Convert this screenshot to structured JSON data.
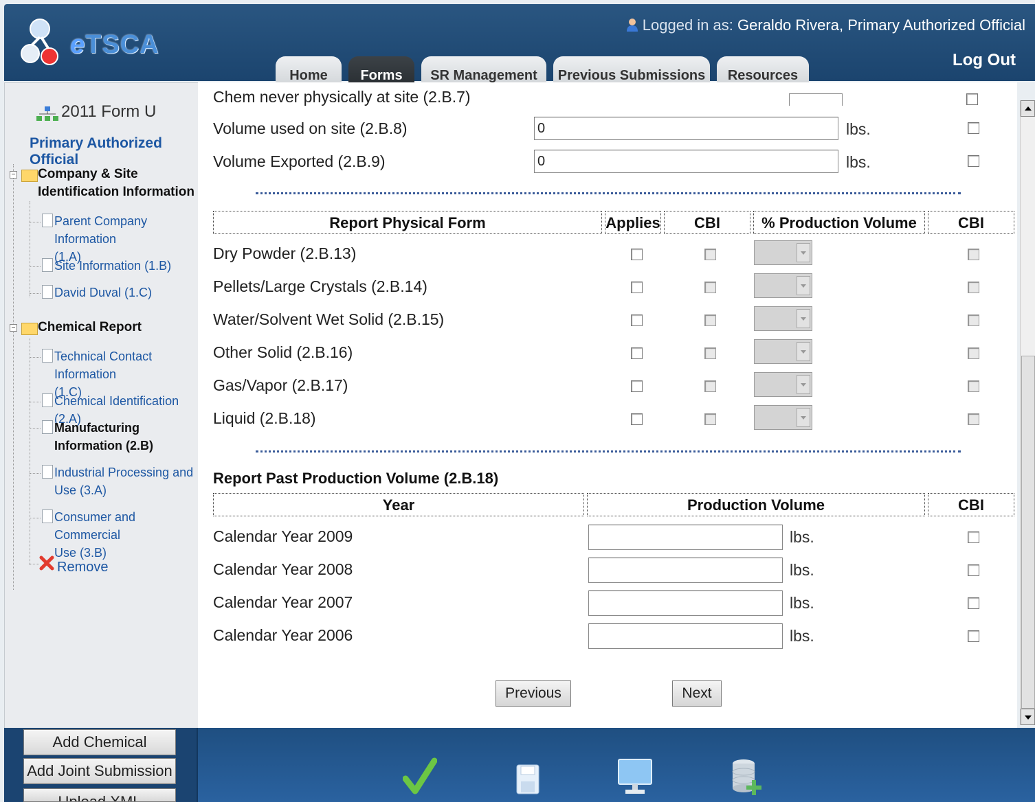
{
  "app": {
    "logo_text_e": "e",
    "logo_text_rest": "TSCA"
  },
  "header": {
    "logged_in_prefix": "Logged in as:",
    "user_name": "Geraldo Rivera, Primary Authorized Official",
    "logout": "Log Out",
    "tabs": [
      {
        "label": "Home",
        "active": false
      },
      {
        "label": "Forms",
        "active": true
      },
      {
        "label": "SR Management",
        "active": false
      },
      {
        "label": "Previous Submissions",
        "active": false
      },
      {
        "label": "Resources",
        "active": false
      }
    ]
  },
  "sidebar": {
    "form_title": "2011 Form U",
    "role": "Primary Authorized Official",
    "folder1": {
      "line1": "Company & Site",
      "line2": "Identification Information"
    },
    "items1": [
      {
        "line1": "Parent Company Information",
        "line2": "(1.A)"
      },
      {
        "line1": "Site Information (1.B)",
        "line2": ""
      },
      {
        "line1": "David Duval (1.C)",
        "line2": ""
      }
    ],
    "folder2": {
      "line1": "Chemical Report"
    },
    "items2": [
      {
        "line1": "Technical Contact Information",
        "line2": "(1.C)"
      },
      {
        "line1": "Chemical Identification (2.A)",
        "line2": ""
      },
      {
        "line1": "Manufacturing",
        "line2": "Information (2.B)"
      },
      {
        "line1": "Industrial Processing and",
        "line2": "Use (3.A)"
      },
      {
        "line1": "Consumer and Commercial",
        "line2": "Use (3.B)"
      }
    ],
    "remove": "Remove",
    "buttons": {
      "add_chemical": "Add Chemical",
      "add_joint": "Add Joint Submission",
      "upload_xml": "Upload XML"
    }
  },
  "main": {
    "partial_top_label": "Chem never physically at site (2.B.7)",
    "volume_rows": [
      {
        "label": "Volume used on site (2.B.8)",
        "value": "0",
        "unit": "lbs."
      },
      {
        "label": "Volume Exported (2.B.9)",
        "value": "0",
        "unit": "lbs."
      }
    ],
    "physical_form": {
      "headers": {
        "form": "Report Physical Form",
        "applies": "Applies",
        "cbi": "CBI",
        "pct": "% Production Volume",
        "cbi2": "CBI"
      },
      "rows": [
        {
          "label": "Dry Powder (2.B.13)"
        },
        {
          "label": "Pellets/Large Crystals (2.B.14)"
        },
        {
          "label": "Water/Solvent Wet Solid (2.B.15)"
        },
        {
          "label": "Other Solid (2.B.16)"
        },
        {
          "label": "Gas/Vapor (2.B.17)"
        },
        {
          "label": "Liquid (2.B.18)"
        }
      ]
    },
    "past_production": {
      "title": "Report Past Production Volume (2.B.18)",
      "headers": {
        "year": "Year",
        "volume": "Production Volume",
        "cbi": "CBI"
      },
      "rows": [
        {
          "label": "Calendar Year 2009",
          "value": "",
          "unit": "lbs."
        },
        {
          "label": "Calendar Year 2008",
          "value": "",
          "unit": "lbs."
        },
        {
          "label": "Calendar Year 2007",
          "value": "",
          "unit": "lbs."
        },
        {
          "label": "Calendar Year 2006",
          "value": "",
          "unit": "lbs."
        }
      ]
    },
    "nav": {
      "previous": "Previous",
      "next": "Next"
    }
  },
  "footer_icons": [
    "checkmark-icon",
    "save-icon",
    "monitor-icon",
    "database-add-icon"
  ]
}
